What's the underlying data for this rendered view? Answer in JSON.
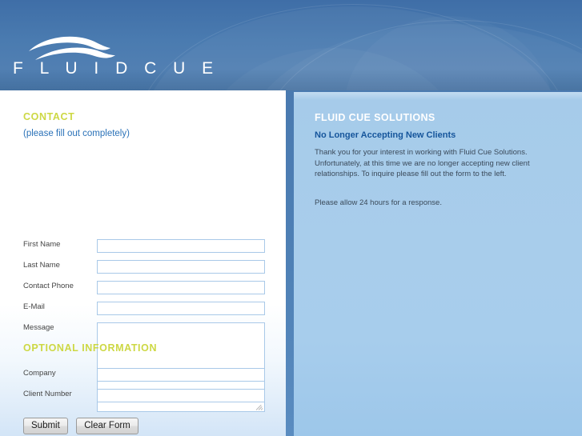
{
  "brand": {
    "logo_text": "F L U I D C U E",
    "logo_wave_icon": "wave-lines-icon"
  },
  "colors": {
    "header_blue_top": "#3f6ea7",
    "header_blue_bottom": "#4d7cae",
    "section_heading_yellow": "#cdd844",
    "link_blue": "#2b72b8",
    "right_panel_blue": "#a8cdeb",
    "right_subheading_blue": "#15559b",
    "input_border_blue": "#a9c9e8"
  },
  "left_panel": {
    "contact_heading": "CONTACT",
    "contact_subheading": "(please fill out completely)",
    "optional_heading": "OPTIONAL INFORMATION",
    "fields": [
      {
        "label": "First Name",
        "value": "",
        "placeholder": ""
      },
      {
        "label": "Last Name",
        "value": "",
        "placeholder": ""
      },
      {
        "label": "Contact Phone",
        "value": "",
        "placeholder": ""
      },
      {
        "label": "E-Mail",
        "value": "",
        "placeholder": ""
      },
      {
        "label": "Message",
        "value": "",
        "placeholder": ""
      }
    ],
    "optional_fields": [
      {
        "label": "Company",
        "value": "",
        "placeholder": ""
      },
      {
        "label": "Client Number",
        "value": "",
        "placeholder": ""
      }
    ],
    "buttons": {
      "submit_label": "Submit",
      "clear_label": "Clear Form"
    }
  },
  "right_panel": {
    "heading": "FLUID CUE SOLUTIONS",
    "subheading": "No Longer Accepting New Clients",
    "paragraph_1": "Thank you for your interest in working with Fluid Cue Solutions. Unfortunately, at this time we are no longer accepting new client relationships. To inquire please fill out the form to the left.",
    "paragraph_2": "Please allow 24 hours for a response."
  }
}
